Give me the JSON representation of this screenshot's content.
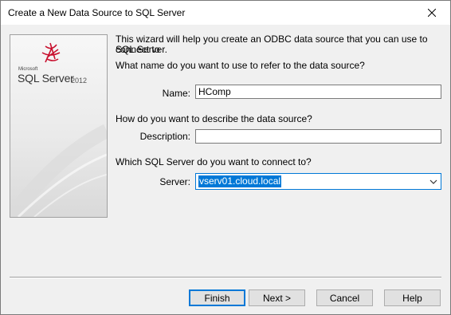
{
  "window": {
    "title": "Create a New Data Source to SQL Server"
  },
  "logo": {
    "microsoft": "Microsoft",
    "product": "SQL Server",
    "year": "2012"
  },
  "intro": {
    "line1": "This wizard will help you create an ODBC data source that you can use to connect to",
    "line2": "SQL Server.",
    "name_question": "What name do you want to use to refer to the data source?",
    "desc_question": "How do you want to describe the data source?",
    "server_question": "Which SQL Server do you want to connect to?"
  },
  "fields": {
    "name_label": "Name:",
    "name_value": "HComp",
    "description_label": "Description:",
    "description_value": "",
    "server_label": "Server:",
    "server_value": "vserv01.cloud.local"
  },
  "buttons": {
    "finish": "Finish",
    "next": "Next >",
    "cancel": "Cancel",
    "help": "Help"
  },
  "icons": {
    "close": "close-icon",
    "logo": "sql-server-logo-icon",
    "dropdown": "chevron-down-icon"
  },
  "colors": {
    "accent": "#0078d7",
    "logo_red": "#c8102e"
  }
}
